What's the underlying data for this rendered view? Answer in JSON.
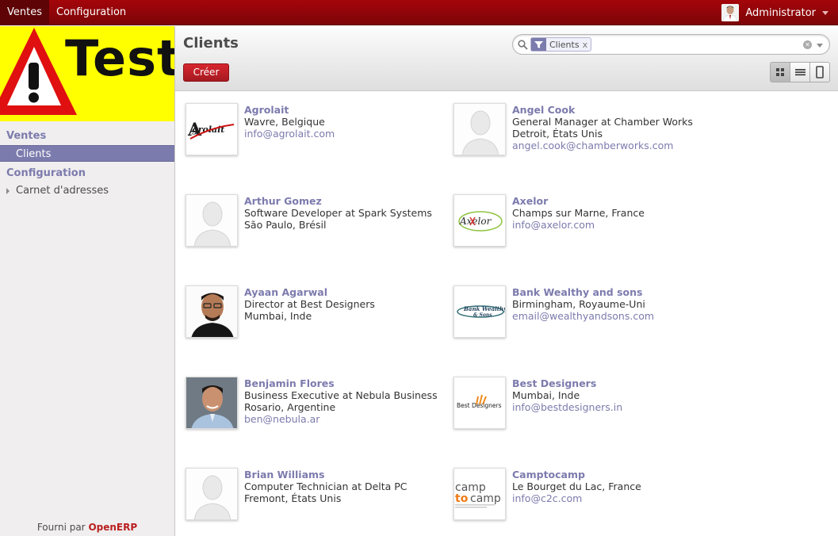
{
  "topmenu": {
    "ventes": "Ventes",
    "configuration": "Configuration"
  },
  "user": {
    "name": "Administrator"
  },
  "logo": {
    "text": "Test"
  },
  "sidebar": {
    "section_ventes": "Ventes",
    "item_clients": "Clients",
    "section_config": "Configuration",
    "item_carnet": "Carnet d'adresses"
  },
  "footer": {
    "prefix": "Fourni par",
    "brand": "OpenERP"
  },
  "header": {
    "title": "Clients",
    "create_label": "Créer"
  },
  "search": {
    "facet_label": "Clients",
    "facet_remove": "x"
  },
  "colors": {
    "topbar": "#8e0509",
    "accent": "#7c7bad",
    "create": "#c1212a",
    "logo_bg": "#ffff00"
  },
  "clients": [
    {
      "name": "Agrolait",
      "l1": "Wavre, Belgique",
      "l2": "",
      "email": "info@agrolait.com",
      "icon": "agrolait-logo"
    },
    {
      "name": "Angel Cook",
      "l1": "General Manager at Chamber Works",
      "l2": "Detroit, États Unis",
      "email": "angel.cook@chamberworks.com",
      "icon": "person-placeholder"
    },
    {
      "name": "Arthur Gomez",
      "l1": "Software Developer at Spark Systems",
      "l2": "São Paulo, Brésil",
      "email": "",
      "icon": "person-placeholder"
    },
    {
      "name": "Axelor",
      "l1": "Champs sur Marne, France",
      "l2": "",
      "email": "info@axelor.com",
      "icon": "axelor-logo"
    },
    {
      "name": "Ayaan Agarwal",
      "l1": "Director at Best Designers",
      "l2": "Mumbai, Inde",
      "email": "",
      "icon": "person-photo"
    },
    {
      "name": "Bank Wealthy and sons",
      "l1": "Birmingham, Royaume-Uni",
      "l2": "",
      "email": "email@wealthyandsons.com",
      "icon": "bank-logo"
    },
    {
      "name": "Benjamin Flores",
      "l1": "Business Executive at Nebula Business",
      "l2": "Rosario, Argentine",
      "email": "ben@nebula.ar",
      "icon": "person-photo"
    },
    {
      "name": "Best Designers",
      "l1": "Mumbai, Inde",
      "l2": "",
      "email": "info@bestdesigners.in",
      "icon": "bestdesigners-logo"
    },
    {
      "name": "Brian Williams",
      "l1": "Computer Technician at Delta PC",
      "l2": "Fremont, États Unis",
      "email": "",
      "icon": "person-placeholder"
    },
    {
      "name": "Camptocamp",
      "l1": "Le Bourget du Lac, France",
      "l2": "",
      "email": "info@c2c.com",
      "icon": "camptocamp-logo"
    }
  ]
}
